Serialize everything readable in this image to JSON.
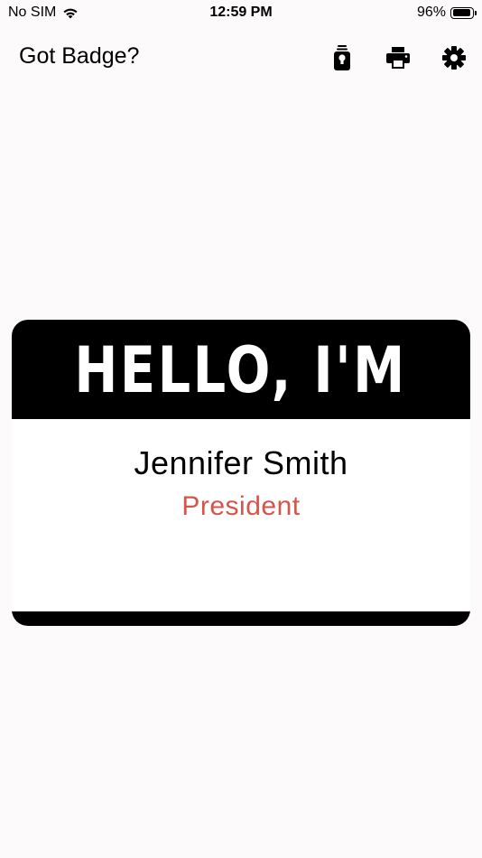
{
  "status_bar": {
    "carrier": "No SIM",
    "time": "12:59 PM",
    "battery_percent": "96%",
    "battery_level": 0.96
  },
  "nav": {
    "title": "Got Badge?",
    "icons": [
      "badge-icon",
      "printer-icon",
      "gear-icon"
    ]
  },
  "badge": {
    "header": "HELLO, I'M",
    "name": "Jennifer Smith",
    "role": "President",
    "role_color": "#d4554a",
    "band_color": "#000000"
  }
}
